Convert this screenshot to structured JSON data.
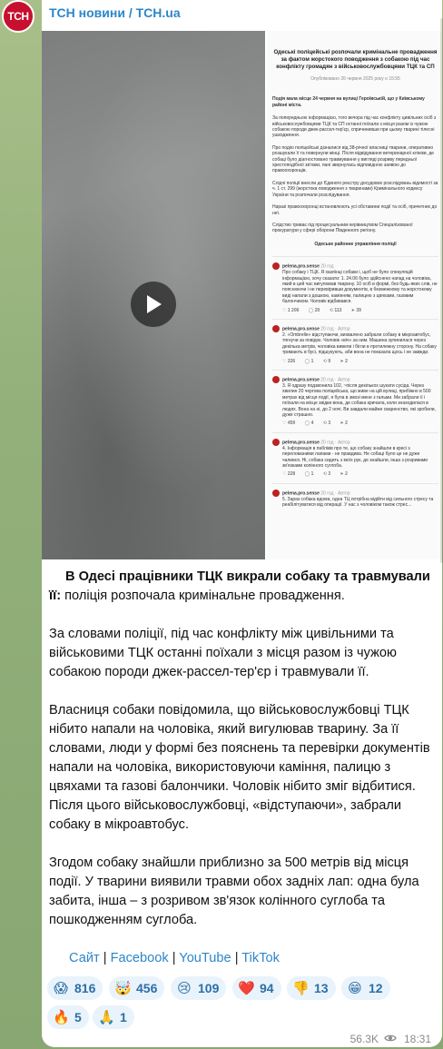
{
  "channel": {
    "avatar_text": "ТСН",
    "title": "ТСН новини / TCH.ua"
  },
  "document": {
    "title": "Одеські поліцейські розпочали кримінальне провадження за фактом жорстокого поводження з собакою під час конфлікту громадян з військовослужбовцями ТЦК та СП",
    "date": "Опубліковано 26 червня 2025 року о 15:55",
    "lead": "Подія мала місце 24 червня на вулиці Героївській, що у Київському районі міста.",
    "paragraphs": [
      "За попередньою інформацією, того вечора під час конфлікту цивільних осіб з військовослужбовцями ТЦК та СП останні поїхали з місця разом із чужою собакою породи джек-рассел-тер'єр, спричинивши при цьому тварині тілесні ушкодження.",
      "Про подію поліцейські дізналися від 38-річної власниці тварини, оперативно розшукали її та повернули жінці. Після відвідування ветеринарної клініки, де собаці було діагностовано травмування у вигляді розриву передньої хрестоподібної зв'язки, пані звернулась відповідною заявою до правоохоронців.",
      "Слідчі поліції внесли до Єдиного реєстру досудових розслідувань відомості за ч. 1 ст. 299 (жорстока поводження з тваринами) Кримінального кодексу України та розпочали розслідування.",
      "Наразі правоохоронці встановлюють усі обставини події та осіб, причетних до неї.",
      "Слідство триває під процесуальним керівництвом Спеціалізованої прокуратури у сфері оборони Південного регіону."
    ],
    "signature": "Одеське районне управління поліції",
    "posts": [
      {
        "user": "pelena.pro.sense",
        "meta": "20 год",
        "text": "Про собаку і ТЦК. Я хазяїнці собаки і, щоб не було спекуляцій інформацією, хочу сказати: 1. 24.06 було здійснено напад на чоловіка, який в цей час вигулював тварину. 10 осіб в формі, без будь-яких слів, не пояснюючи і не перевіривши документів, в безмежному та жорстокому виді напали з дошкою, камінням, палицею з цвяхами, газовим балончиком. Чоловік відбивався.",
        "stats": [
          "1 206",
          "20",
          "113",
          "39"
        ]
      },
      {
        "user": "pelena.pro.sense",
        "meta": "20 год · Автор",
        "text": "2. «Ombrelle» відступаючи, вихвалено забрали собаку в мікроавтобус, тягнучи за повідок. Чоловік «віч» за ним. Машина зупинилася через декілька метрів, чоловіка вивели і бігли в протилежну сторону. На собаку тримають в бусі, підшукують, аби вона не показала щось і не завжди.",
        "stats": [
          "226",
          "1",
          "9",
          "2"
        ]
      },
      {
        "user": "pelena.pro.sense",
        "meta": "20 год · Автор",
        "text": "3. Я одразу подзвонила 102, ~після декількох шукати сусіда. Через хвилин 20 чергова поліцейська, що живе на цій вулиці, прибіжно в 500 метрах від місця події, я була в змозі мене з гальми. Ми забрали її і поїхали на місце звідки вона, де собака кричала, коли знаходилася в людях. Вона на ні, до 2 ночі. Ви завдали майже сваренство, які зробили, дуже страшно.",
        "stats": [
          "459",
          "4",
          "3",
          "2"
        ]
      },
      {
        "user": "pelena.pro.sense",
        "meta": "20 год · Автор",
        "text": "4. Інформація в пабліків про те, що собаку знайшли в кресі з переломаними лапами - не правдива. Не собаці було це не дуже чалився. Ні, собака сидить з моїх рук, де знайшли, інша з розривами зв'язками колінного суглоба.",
        "stats": [
          "228",
          "1",
          "3",
          "2"
        ]
      },
      {
        "user": "pelena.pro.sense",
        "meta": "20 год · Автор",
        "text": "5. Зараз собака вдома, одна ТЦ потрібна відійти від сильного стресу та реабілітуватися від операції. У нас з чоловіком також стрес...",
        "stats": []
      }
    ]
  },
  "message": {
    "headline": "В Одесі працівники ТЦК викрали собаку та травмували її:",
    "headline_rest": " поліція розпочала кримінальне провадження.",
    "paragraphs": [
      "За словами поліції, під час конфлікту між цивільними та військовими ТЦК останні поїхали з місця разом із чужою собакою породи джек-рассел-тер'єр і травмували її.",
      "Власниця собаки повідомила, що військовослужбовці ТЦК нібито напали на чоловіка, який вигулював тварину. За її словами, люди у формі без пояснень та перевірки документів напали на чоловіка, використовуючи каміння, палицю з цвяхами та газові балончики. Чоловік нібито зміг відбитися. Після цього військовослужбовці, «відступаючи», забрали собаку в мікроавтобус.",
      "Згодом собаку знайшли приблизно за 500 метрів від місця події. У тварини виявили травми обох задніх лап: одна була забита, інша – з розривом зв'язок колінного суглоба та пошкодженням суглоба."
    ],
    "links": [
      "Сайт",
      "Facebook",
      "YouTube",
      "TikTok"
    ],
    "separator": " | "
  },
  "reactions": [
    {
      "emoji": "😱",
      "count": "816"
    },
    {
      "emoji": "🤯",
      "count": "456"
    },
    {
      "emoji": "😢",
      "count": "109"
    },
    {
      "emoji": "❤️",
      "count": "94"
    },
    {
      "emoji": "👎",
      "count": "13"
    },
    {
      "emoji": "😁",
      "count": "12"
    },
    {
      "emoji": "🔥",
      "count": "5"
    },
    {
      "emoji": "🙏",
      "count": "1"
    }
  ],
  "footer": {
    "views": "56.3K",
    "time": "18:31"
  }
}
